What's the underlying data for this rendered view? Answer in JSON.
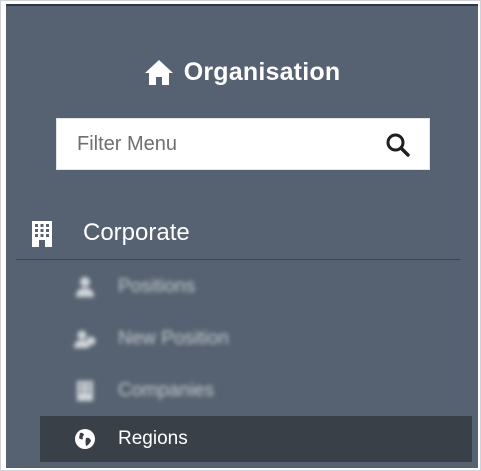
{
  "header": {
    "title": "Organisation",
    "icon": "home-icon"
  },
  "search": {
    "placeholder": "Filter Menu",
    "icon": "search-icon"
  },
  "section": {
    "label": "Corporate",
    "icon": "building-icon"
  },
  "items": [
    {
      "label": "Positions",
      "icon": "person-icon",
      "blurred": true
    },
    {
      "label": "New Position",
      "icon": "add-person-icon",
      "blurred": true
    },
    {
      "label": "Companies",
      "icon": "building-icon",
      "blurred": true
    },
    {
      "label": "Regions",
      "icon": "globe-icon",
      "active": true
    }
  ],
  "colors": {
    "panel": "#566271",
    "active_item": "#3a4048",
    "text": "#ffffff"
  }
}
